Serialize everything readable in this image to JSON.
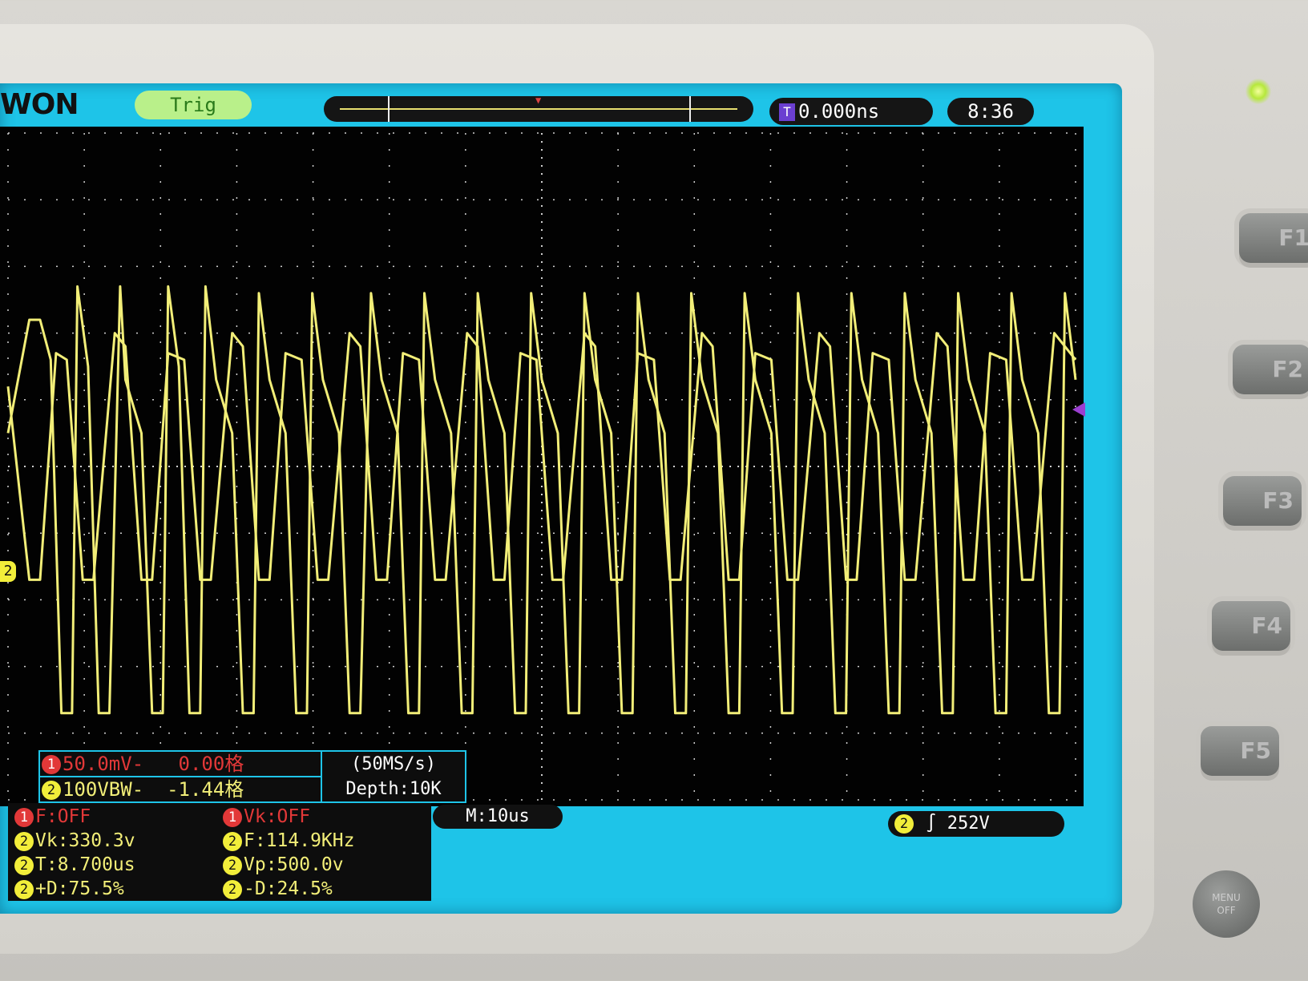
{
  "brand": "WON",
  "status": {
    "trig": "Trig"
  },
  "trigger_time": {
    "badge": "T",
    "value": "0.000ns"
  },
  "clock": "8:36",
  "channel_info": [
    {
      "num": "1",
      "text": "50.0mV-",
      "offset": "0.00格"
    },
    {
      "num": "2",
      "text": "100VBW-",
      "offset": "-1.44格"
    }
  ],
  "sample": {
    "rate": "(50MS/s)",
    "depth": "Depth:10K"
  },
  "measurements": {
    "left": [
      {
        "ch": "1",
        "text": "F:OFF"
      },
      {
        "ch": "2",
        "text": "Vk:330.3v"
      },
      {
        "ch": "2",
        "text": "T:8.700us"
      },
      {
        "ch": "2",
        "text": "+D:75.5%"
      }
    ],
    "right": [
      {
        "ch": "1",
        "text": "Vk:OFF"
      },
      {
        "ch": "2",
        "text": "F:114.9KHz"
      },
      {
        "ch": "2",
        "text": "Vp:500.0v"
      },
      {
        "ch": "2",
        "text": "-D:24.5%"
      }
    ]
  },
  "timebase": "M:10us",
  "trigger": {
    "ch": "2",
    "level": "252V"
  },
  "ch2_marker": "2",
  "function_keys": [
    "F1",
    "F2",
    "F3",
    "F4",
    "F5"
  ],
  "menu_off": [
    "MENU",
    "OFF"
  ],
  "colors": {
    "ch1": "#e23838",
    "ch2": "#f2ee78",
    "screen": "#1ec4e8",
    "trigger_marker": "#9b3fd1"
  },
  "chart_data": {
    "type": "line",
    "series": [
      {
        "values": [
          [
            0,
            0.5
          ],
          [
            2,
            2.2
          ],
          [
            3,
            2.2
          ],
          [
            4,
            1.6
          ],
          [
            5,
            -3.7
          ],
          [
            6,
            -3.7
          ],
          [
            6.5,
            2.7
          ],
          [
            7.5,
            1.5
          ],
          [
            8.5,
            -3.7
          ],
          [
            9.5,
            -3.7
          ],
          [
            10.5,
            2.7
          ],
          [
            11,
            1.3
          ],
          [
            12.5,
            0.5
          ],
          [
            13.5,
            -3.7
          ],
          [
            14.5,
            -3.7
          ],
          [
            15,
            2.7
          ],
          [
            16,
            1.5
          ],
          [
            17,
            -3.7
          ],
          [
            18,
            -3.7
          ],
          [
            18.5,
            2.7
          ],
          [
            19.5,
            1.3
          ],
          [
            21,
            0.5
          ],
          [
            22,
            -3.7
          ],
          [
            23,
            -3.7
          ],
          [
            23.5,
            2.6
          ],
          [
            24.5,
            1.3
          ],
          [
            26,
            0.5
          ],
          [
            27,
            -3.7
          ],
          [
            28,
            -3.7
          ],
          [
            28.5,
            2.6
          ],
          [
            29.5,
            1.3
          ],
          [
            31,
            0.5
          ],
          [
            32,
            -3.7
          ],
          [
            33,
            -3.7
          ],
          [
            34,
            2.6
          ],
          [
            35,
            1.3
          ],
          [
            36.5,
            0.5
          ],
          [
            37.5,
            -3.7
          ],
          [
            38.5,
            -3.7
          ],
          [
            39,
            2.6
          ],
          [
            40,
            1.3
          ],
          [
            41.5,
            0.5
          ],
          [
            42.5,
            -3.7
          ],
          [
            43.5,
            -3.7
          ],
          [
            44,
            2.6
          ],
          [
            45,
            1.3
          ],
          [
            46.5,
            0.5
          ],
          [
            47.5,
            -3.7
          ],
          [
            48.5,
            -3.7
          ],
          [
            49,
            2.6
          ],
          [
            50,
            1.3
          ],
          [
            51.5,
            0.5
          ],
          [
            52.5,
            -3.7
          ],
          [
            53.5,
            -3.7
          ],
          [
            54,
            2.6
          ],
          [
            55,
            1.3
          ],
          [
            56.5,
            0.5
          ],
          [
            57.5,
            -3.7
          ],
          [
            58.5,
            -3.7
          ],
          [
            59,
            2.6
          ],
          [
            60,
            1.3
          ],
          [
            61.5,
            0.5
          ],
          [
            62.5,
            -3.7
          ],
          [
            63.5,
            -3.7
          ],
          [
            64,
            2.6
          ],
          [
            65,
            1.3
          ],
          [
            66.5,
            0.5
          ],
          [
            67.5,
            -3.7
          ],
          [
            68.5,
            -3.7
          ],
          [
            69,
            2.6
          ],
          [
            70,
            1.3
          ],
          [
            71.5,
            0.5
          ],
          [
            72.5,
            -3.7
          ],
          [
            73.5,
            -3.7
          ],
          [
            74,
            2.6
          ],
          [
            75,
            1.3
          ],
          [
            76.5,
            0.5
          ],
          [
            77.5,
            -3.7
          ],
          [
            78.5,
            -3.7
          ],
          [
            79,
            2.6
          ],
          [
            80,
            1.3
          ],
          [
            81.5,
            0.5
          ],
          [
            82.5,
            -3.7
          ],
          [
            83.5,
            -3.7
          ],
          [
            84,
            2.6
          ],
          [
            85,
            1.3
          ],
          [
            86.5,
            0.5
          ],
          [
            87.5,
            -3.7
          ],
          [
            88.5,
            -3.7
          ],
          [
            89,
            2.6
          ],
          [
            90,
            1.3
          ],
          [
            91.5,
            0.5
          ],
          [
            92.5,
            -3.7
          ],
          [
            93.5,
            -3.7
          ],
          [
            94,
            2.6
          ],
          [
            95,
            1.3
          ],
          [
            96.5,
            0.5
          ],
          [
            97.5,
            -3.7
          ],
          [
            98.5,
            -3.7
          ],
          [
            99,
            2.6
          ],
          [
            100,
            1.3
          ]
        ]
      },
      {
        "values": [
          [
            0,
            1.2
          ],
          [
            2,
            -1.7
          ],
          [
            3,
            -1.7
          ],
          [
            4.5,
            1.7
          ],
          [
            5.5,
            1.6
          ],
          [
            7,
            -1.7
          ],
          [
            8,
            -1.7
          ],
          [
            10,
            2.0
          ],
          [
            11,
            1.8
          ],
          [
            12.5,
            -1.7
          ],
          [
            13.5,
            -1.7
          ],
          [
            15,
            1.7
          ],
          [
            16.5,
            1.6
          ],
          [
            18,
            -1.7
          ],
          [
            19,
            -1.7
          ],
          [
            21,
            2.0
          ],
          [
            22,
            1.8
          ],
          [
            23.5,
            -1.7
          ],
          [
            24.5,
            -1.7
          ],
          [
            26,
            1.7
          ],
          [
            27.5,
            1.6
          ],
          [
            29,
            -1.7
          ],
          [
            30,
            -1.7
          ],
          [
            32,
            2.0
          ],
          [
            33,
            1.8
          ],
          [
            34.5,
            -1.7
          ],
          [
            35.5,
            -1.7
          ],
          [
            37,
            1.7
          ],
          [
            38.5,
            1.6
          ],
          [
            40,
            -1.7
          ],
          [
            41,
            -1.7
          ],
          [
            43,
            2.0
          ],
          [
            44,
            1.8
          ],
          [
            45.5,
            -1.7
          ],
          [
            46.5,
            -1.7
          ],
          [
            48,
            1.7
          ],
          [
            49.5,
            1.6
          ],
          [
            51,
            -1.7
          ],
          [
            52,
            -1.7
          ],
          [
            54,
            2.0
          ],
          [
            55,
            1.8
          ],
          [
            56.5,
            -1.7
          ],
          [
            57.5,
            -1.7
          ],
          [
            59,
            1.7
          ],
          [
            60.5,
            1.6
          ],
          [
            62,
            -1.7
          ],
          [
            63,
            -1.7
          ],
          [
            65,
            2.0
          ],
          [
            66,
            1.8
          ],
          [
            67.5,
            -1.7
          ],
          [
            68.5,
            -1.7
          ],
          [
            70,
            1.7
          ],
          [
            71.5,
            1.6
          ],
          [
            73,
            -1.7
          ],
          [
            74,
            -1.7
          ],
          [
            76,
            2.0
          ],
          [
            77,
            1.8
          ],
          [
            78.5,
            -1.7
          ],
          [
            79.5,
            -1.7
          ],
          [
            81,
            1.7
          ],
          [
            82.5,
            1.6
          ],
          [
            84,
            -1.7
          ],
          [
            85,
            -1.7
          ],
          [
            87,
            2.0
          ],
          [
            88,
            1.8
          ],
          [
            89.5,
            -1.7
          ],
          [
            90.5,
            -1.7
          ],
          [
            92,
            1.7
          ],
          [
            93.5,
            1.6
          ],
          [
            95,
            -1.7
          ],
          [
            96,
            -1.7
          ],
          [
            98,
            2.0
          ],
          [
            100,
            1.6
          ]
        ]
      }
    ],
    "xlim": [
      0,
      100
    ],
    "ylim": [
      -5,
      5
    ],
    "grid": true
  }
}
